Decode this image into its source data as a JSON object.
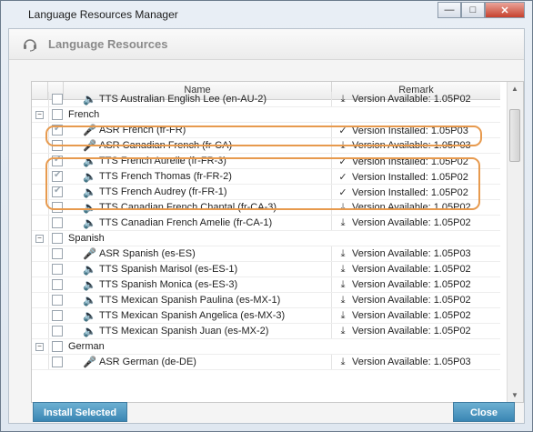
{
  "window": {
    "title": "Language Resources Manager",
    "minimize_icon": "minimize-icon",
    "maximize_icon": "maximize-icon",
    "close_icon": "close-icon"
  },
  "header": {
    "title": "Language Resources",
    "icon": "headset-icon"
  },
  "grid": {
    "columns": [
      "Name",
      "Remark"
    ],
    "rows": [
      {
        "type": "item",
        "indent": 2,
        "icon": "speaker-icon",
        "name": "TTS Australian English Lee (en-AU-2)",
        "checked": false,
        "remark_icon": "download-icon",
        "remark": "Version Available: 1.05P02"
      },
      {
        "type": "group",
        "name": "French",
        "expanded": true
      },
      {
        "type": "item",
        "indent": 2,
        "icon": "microphone-icon",
        "name": "ASR French (fr-FR)",
        "checked": true,
        "remark_icon": "check-icon",
        "remark": "Version Installed: 1.05P03"
      },
      {
        "type": "item",
        "indent": 2,
        "icon": "microphone-icon",
        "name": "ASR Canadian French (fr-CA)",
        "checked": false,
        "remark_icon": "download-icon",
        "remark": "Version Available: 1.05P03"
      },
      {
        "type": "item",
        "indent": 2,
        "icon": "speaker-icon",
        "name": "TTS French Aurelie (fr-FR-3)",
        "checked": true,
        "remark_icon": "check-icon",
        "remark": "Version Installed: 1.05P02"
      },
      {
        "type": "item",
        "indent": 2,
        "icon": "speaker-icon",
        "name": "TTS French Thomas (fr-FR-2)",
        "checked": true,
        "remark_icon": "check-icon",
        "remark": "Version Installed: 1.05P02"
      },
      {
        "type": "item",
        "indent": 2,
        "icon": "speaker-icon",
        "name": "TTS French Audrey (fr-FR-1)",
        "checked": true,
        "remark_icon": "check-icon",
        "remark": "Version Installed: 1.05P02"
      },
      {
        "type": "item",
        "indent": 2,
        "icon": "speaker-icon",
        "name": "TTS Canadian French Chantal (fr-CA-3)",
        "checked": false,
        "remark_icon": "download-icon",
        "remark": "Version Available: 1.05P02"
      },
      {
        "type": "item",
        "indent": 2,
        "icon": "speaker-icon",
        "name": "TTS Canadian French Amelie (fr-CA-1)",
        "checked": false,
        "remark_icon": "download-icon",
        "remark": "Version Available: 1.05P02"
      },
      {
        "type": "group",
        "name": "Spanish",
        "expanded": true
      },
      {
        "type": "item",
        "indent": 2,
        "icon": "microphone-icon",
        "name": "ASR Spanish (es-ES)",
        "checked": false,
        "remark_icon": "download-icon",
        "remark": "Version Available: 1.05P03"
      },
      {
        "type": "item",
        "indent": 2,
        "icon": "speaker-icon",
        "name": "TTS Spanish Marisol (es-ES-1)",
        "checked": false,
        "remark_icon": "download-icon",
        "remark": "Version Available: 1.05P02"
      },
      {
        "type": "item",
        "indent": 2,
        "icon": "speaker-icon",
        "name": "TTS Spanish Monica (es-ES-3)",
        "checked": false,
        "remark_icon": "download-icon",
        "remark": "Version Available: 1.05P02"
      },
      {
        "type": "item",
        "indent": 2,
        "icon": "speaker-icon",
        "name": "TTS Mexican Spanish Paulina (es-MX-1)",
        "checked": false,
        "remark_icon": "download-icon",
        "remark": "Version Available: 1.05P02"
      },
      {
        "type": "item",
        "indent": 2,
        "icon": "speaker-icon",
        "name": "TTS Mexican Spanish Angelica (es-MX-3)",
        "checked": false,
        "remark_icon": "download-icon",
        "remark": "Version Available: 1.05P02"
      },
      {
        "type": "item",
        "indent": 2,
        "icon": "speaker-icon",
        "name": "TTS Mexican Spanish Juan (es-MX-2)",
        "checked": false,
        "remark_icon": "download-icon",
        "remark": "Version Available: 1.05P02"
      },
      {
        "type": "group",
        "name": "German",
        "expanded": true
      },
      {
        "type": "item",
        "indent": 2,
        "icon": "microphone-icon",
        "name": "ASR German (de-DE)",
        "checked": false,
        "remark_icon": "download-icon",
        "remark": "Version Available: 1.05P03"
      }
    ]
  },
  "buttons": {
    "install_selected": "Install Selected",
    "close": "Close"
  },
  "colors": {
    "annotation": "#e79a4e",
    "button_fill": "#3a86b4"
  }
}
